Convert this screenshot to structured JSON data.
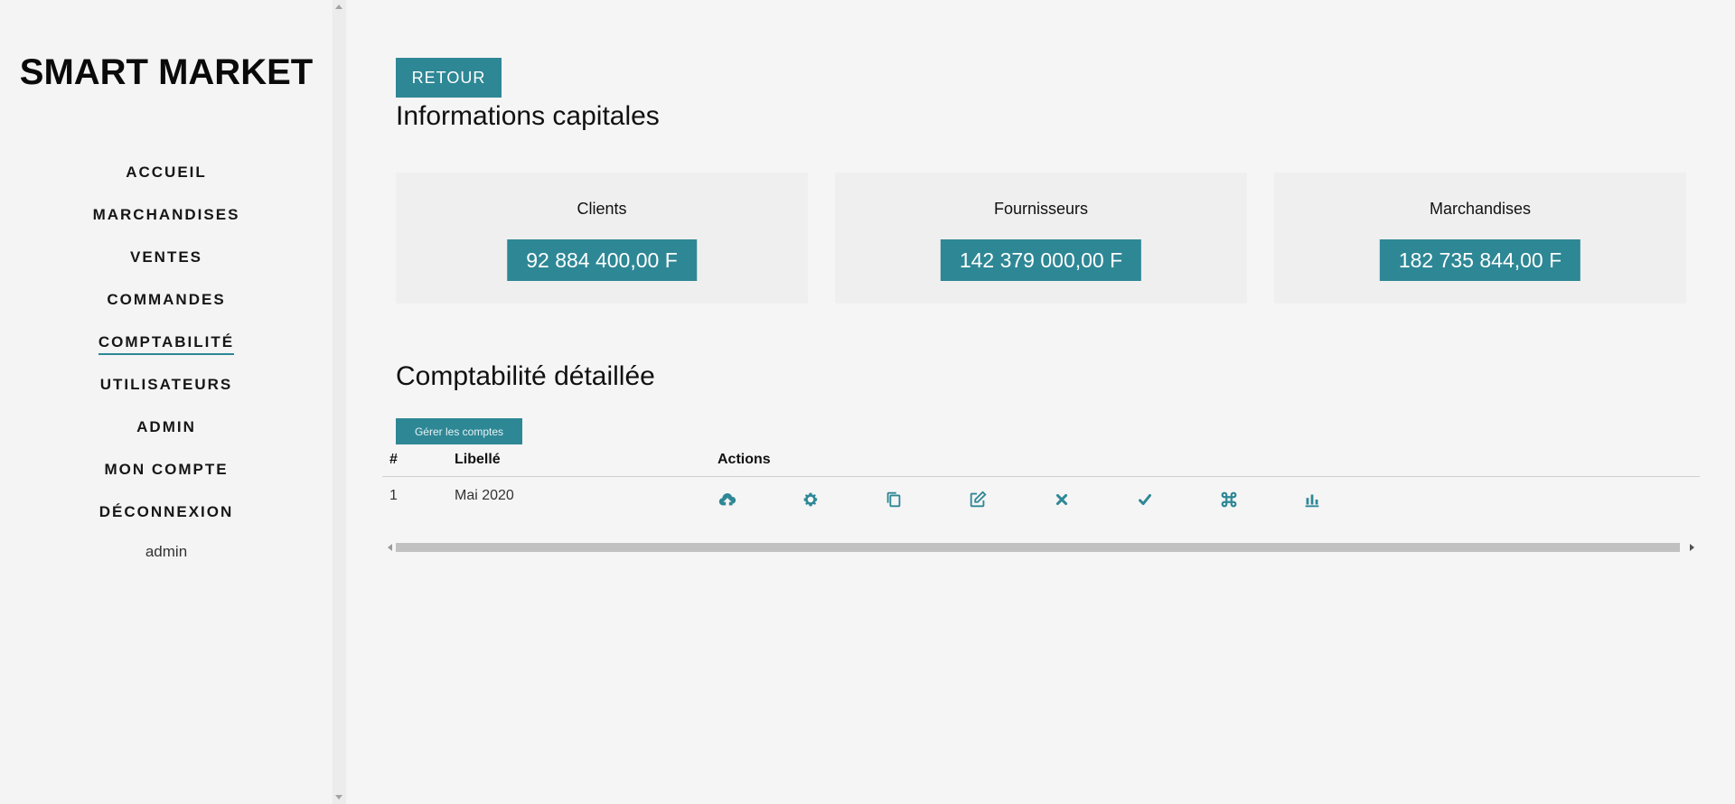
{
  "sidebar": {
    "brand": "SMART MARKET",
    "items": [
      {
        "label": "ACCUEIL"
      },
      {
        "label": "MARCHANDISES"
      },
      {
        "label": "VENTES"
      },
      {
        "label": "COMMANDES"
      },
      {
        "label": "COMPTABILITÉ",
        "active": true
      },
      {
        "label": "UTILISATEURS"
      },
      {
        "label": "ADMIN"
      },
      {
        "label": "MON COMPTE"
      },
      {
        "label": "DÉCONNEXION"
      }
    ],
    "user": "admin"
  },
  "main": {
    "back_button": "RETOUR",
    "capital_title": "Informations capitales",
    "cards": [
      {
        "label": "Clients",
        "value": "92 884 400,00 F"
      },
      {
        "label": "Fournisseurs",
        "value": "142 379 000,00 F"
      },
      {
        "label": "Marchandises",
        "value": "182 735 844,00 F"
      }
    ],
    "detail_title": "Comptabilité détaillée",
    "manage_button": "Gérer les comptes",
    "table": {
      "headers": {
        "num": "#",
        "libelle": "Libellé",
        "actions": "Actions"
      },
      "rows": [
        {
          "num": "1",
          "libelle": "Mai 2020"
        }
      ]
    },
    "action_icons": [
      "cloud-upload-icon",
      "gear-icon",
      "copy-icon",
      "edit-icon",
      "close-icon",
      "check-icon",
      "command-icon",
      "bar-chart-icon"
    ]
  },
  "colors": {
    "accent": "#2e8795",
    "background": "#f5f5f5",
    "card_background": "#efefef"
  }
}
